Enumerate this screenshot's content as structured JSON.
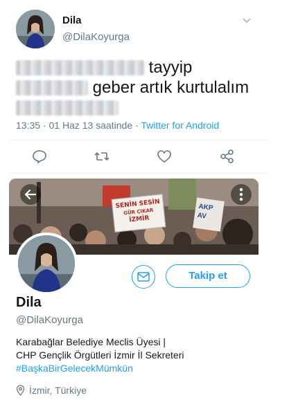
{
  "tweet": {
    "author_name": "Dila",
    "author_handle": "@DilaKoyurga",
    "text_visible_1": "tayyip",
    "text_visible_2": "geber artık kurtulalım",
    "timestamp": "13:35 · 01 Haz 13 saatinde · ",
    "source": "Twitter for Android",
    "actions": [
      "reply-icon",
      "retweet-icon",
      "like-icon",
      "share-icon"
    ]
  },
  "profile": {
    "name": "Dila",
    "handle": "@DilaKoyurga",
    "follow_label": "Takip et",
    "bio_line_1": "Karabağlar Belediye Meclis Üyesi |",
    "bio_line_2": "CHP Gençlik Örgütleri İzmir İl Sekreteri",
    "bio_hashtag": "#BaşkaBirGelecekMümkün",
    "location": "İzmir, Türkiye",
    "banner_sign_1": "SENİN SESİN",
    "banner_sign_2": "GÜR ÇIKAR",
    "banner_sign_3": "İZMİR",
    "banner_sign_4": "AKP",
    "banner_sign_5": "AV"
  },
  "colors": {
    "accent": "#1da1f2",
    "muted": "#657786",
    "text": "#14171a"
  }
}
